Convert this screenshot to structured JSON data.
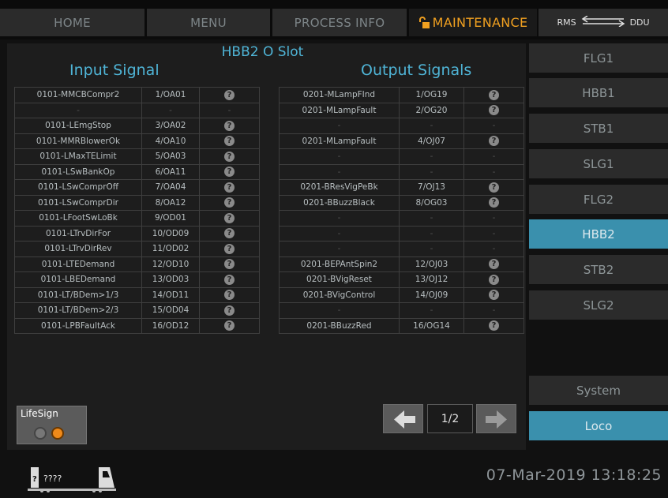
{
  "nav": {
    "tabs": [
      {
        "label": "HOME"
      },
      {
        "label": "MENU"
      },
      {
        "label": "PROCESS INFO"
      },
      {
        "label": "MAINTENANCE"
      }
    ],
    "rms_label": "RMS",
    "ddu_label": "DDU"
  },
  "slot_title": "HBB2 O Slot",
  "input_title": "Input Signal",
  "output_title": "Output Signals",
  "input_rows": [
    {
      "name": "0101-MMCBCompr2",
      "code": "1/OA01",
      "q": "?"
    },
    {
      "name": "-",
      "code": "-",
      "q": "-"
    },
    {
      "name": "0101-LEmgStop",
      "code": "3/OA02",
      "q": "?"
    },
    {
      "name": "0101-MMRBlowerOk",
      "code": "4/OA10",
      "q": "?"
    },
    {
      "name": "0101-LMaxTELimit",
      "code": "5/OA03",
      "q": "?"
    },
    {
      "name": "0101-LSwBankOp",
      "code": "6/OA11",
      "q": "?"
    },
    {
      "name": "0101-LSwComprOff",
      "code": "7/OA04",
      "q": "?"
    },
    {
      "name": "0101-LSwComprDir",
      "code": "8/OA12",
      "q": "?"
    },
    {
      "name": "0101-LFootSwLoBk",
      "code": "9/OD01",
      "q": "?"
    },
    {
      "name": "0101-LTrvDirFor",
      "code": "10/OD09",
      "q": "?"
    },
    {
      "name": "0101-LTrvDirRev",
      "code": "11/OD02",
      "q": "?"
    },
    {
      "name": "0101-LTEDemand",
      "code": "12/OD10",
      "q": "?"
    },
    {
      "name": "0101-LBEDemand",
      "code": "13/OD03",
      "q": "?"
    },
    {
      "name": "0101-LT/BDem>1/3",
      "code": "14/OD11",
      "q": "?"
    },
    {
      "name": "0101-LT/BDem>2/3",
      "code": "15/OD04",
      "q": "?"
    },
    {
      "name": "0101-LPBFaultAck",
      "code": "16/OD12",
      "q": "?"
    }
  ],
  "output_rows": [
    {
      "name": "0201-MLampFInd",
      "code": "1/OG19",
      "q": "?"
    },
    {
      "name": "0201-MLampFault",
      "code": "2/OG20",
      "q": "?"
    },
    {
      "name": "-",
      "code": "-",
      "q": "-"
    },
    {
      "name": "0201-MLampFault",
      "code": "4/OJ07",
      "q": "?"
    },
    {
      "name": "-",
      "code": "-",
      "q": "-"
    },
    {
      "name": "-",
      "code": "-",
      "q": "-"
    },
    {
      "name": "0201-BResVigPeBk",
      "code": "7/OJ13",
      "q": "?"
    },
    {
      "name": "0201-BBuzzBlack",
      "code": "8/OG03",
      "q": "?"
    },
    {
      "name": "-",
      "code": "-",
      "q": "-"
    },
    {
      "name": "-",
      "code": "-",
      "q": "-"
    },
    {
      "name": "-",
      "code": "-",
      "q": "-"
    },
    {
      "name": "0201-BEPAntSpin2",
      "code": "12/OJ03",
      "q": "?"
    },
    {
      "name": "0201-BVigReset",
      "code": "13/OJ12",
      "q": "?"
    },
    {
      "name": "0201-BVigControl",
      "code": "14/OJ09",
      "q": "?"
    },
    {
      "name": "-",
      "code": "-",
      "q": "-"
    },
    {
      "name": "0201-BBuzzRed",
      "code": "16/OG14",
      "q": "?"
    }
  ],
  "lifesign": {
    "label": "LifeSign",
    "led_off_color": "#777777",
    "led_on_color": "#f08a1a"
  },
  "paging": {
    "page": "1/2"
  },
  "sidebar": {
    "items": [
      {
        "label": "FLG1"
      },
      {
        "label": "HBB1"
      },
      {
        "label": "STB1"
      },
      {
        "label": "SLG1"
      },
      {
        "label": "FLG2"
      },
      {
        "label": "HBB2",
        "active": true
      },
      {
        "label": "STB2"
      },
      {
        "label": "SLG2"
      }
    ],
    "system_label": "System",
    "loco_label": "Loco"
  },
  "status": {
    "loco_id": "????",
    "datetime": "07-Mar-2019 13:18:25"
  },
  "colors": {
    "accent": "#4fb4d6",
    "active_tab": "#f0a020",
    "selected": "#3a90ad"
  }
}
